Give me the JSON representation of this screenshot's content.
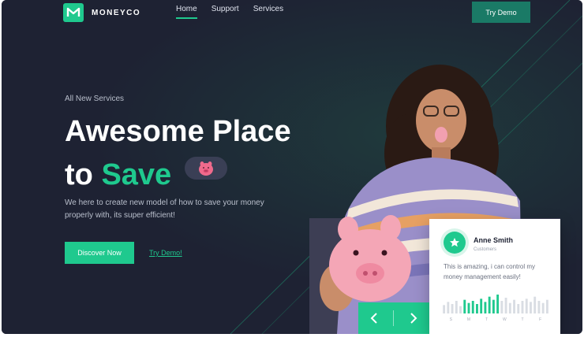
{
  "brand": {
    "name": "MONEYCO",
    "logo_glyph": "M"
  },
  "nav": {
    "items": [
      {
        "label": "Home",
        "active": true
      },
      {
        "label": "Support",
        "active": false
      },
      {
        "label": "Services",
        "active": false
      }
    ],
    "cta_label": "Try Demo"
  },
  "hero": {
    "eyebrow": "All New Services",
    "headline_line1": "Awesome Place",
    "headline_line2_prefix": "to",
    "headline_line2_accent": "Save",
    "description": "We here to create new model of how to save your money properly with, its super efficient!",
    "primary_button": "Discover Now",
    "secondary_link": "Try Demo!"
  },
  "testimonial": {
    "name": "Anne Smith",
    "role": "Customers",
    "quote": "This is amazing, i can control my money management easily!",
    "chart": {
      "labels": [
        "S",
        "M",
        "T",
        "W",
        "T",
        "F"
      ],
      "bars": [
        8,
        11,
        9,
        12,
        7,
        13,
        10,
        12,
        9,
        14,
        11,
        16,
        13,
        18,
        12,
        15,
        10,
        13,
        9,
        12,
        14,
        11,
        16,
        12,
        10,
        13
      ],
      "highlight_range": [
        5,
        13
      ]
    }
  },
  "colors": {
    "accent": "#1fc98e",
    "background": "#1e2233",
    "card": "#ffffff"
  }
}
